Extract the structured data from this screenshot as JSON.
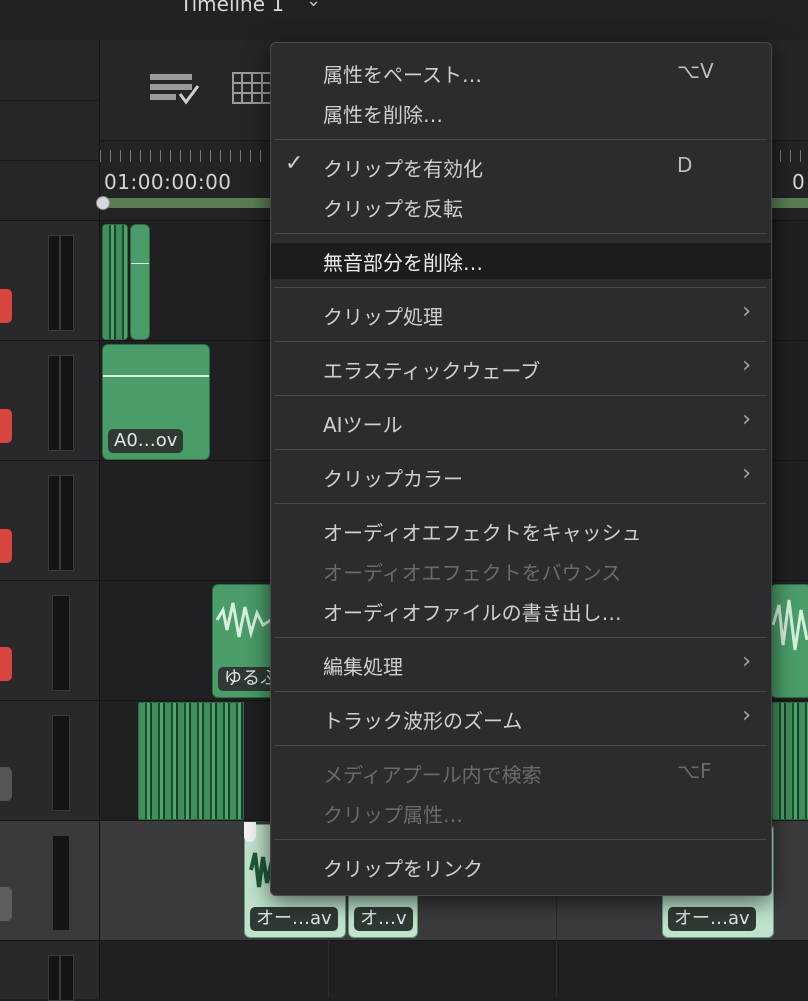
{
  "timeline": {
    "title": "Timeline 1",
    "timecode_start": "01:00:00:00",
    "timecode_next": "0"
  },
  "clips": {
    "a2": "A0…ov",
    "a4": "ゆるふ",
    "a6_1": "オー…av",
    "a6_2": "オ…v",
    "a6_3": "オー…av"
  },
  "menu": {
    "paste_attributes": {
      "label": "属性をペースト…",
      "shortcut": "⌥V"
    },
    "remove_attributes": {
      "label": "属性を削除…"
    },
    "enable_clip": {
      "label": "クリップを有効化",
      "shortcut": "D",
      "check": "✓"
    },
    "reverse_clip": {
      "label": "クリップを反転"
    },
    "delete_silence": {
      "label": "無音部分を削除…"
    },
    "clip_processing": {
      "label": "クリップ処理"
    },
    "elastic_wave": {
      "label": "エラスティックウェーブ"
    },
    "ai_tools": {
      "label": "AIツール"
    },
    "clip_color": {
      "label": "クリップカラー"
    },
    "cache_audio_fx": {
      "label": "オーディオエフェクトをキャッシュ"
    },
    "bounce_audio_fx": {
      "label": "オーディオエフェクトをバウンス"
    },
    "export_audio_file": {
      "label": "オーディオファイルの書き出し…"
    },
    "edit_processing": {
      "label": "編集処理"
    },
    "zoom_waveform": {
      "label": "トラック波形のズーム"
    },
    "find_in_media_pool": {
      "label": "メディアプール内で検索",
      "shortcut": "⌥F"
    },
    "clip_attributes": {
      "label": "クリップ属性…"
    },
    "link_clips": {
      "label": "クリップをリンク"
    },
    "submenu_arrow": "›"
  },
  "colors": {
    "record": "#d8473d",
    "clip_green": "#4a9d68",
    "clip_light": "#bfe3cd",
    "menu_bg": "#2c2c2e"
  }
}
